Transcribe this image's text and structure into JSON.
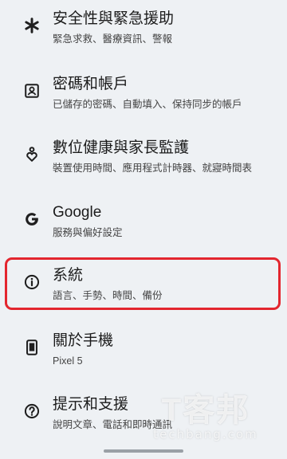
{
  "settings": {
    "items": [
      {
        "icon": "asterisk-icon",
        "title": "安全性與緊急援助",
        "subtitle": "緊急求救、醫療資訊、警報"
      },
      {
        "icon": "account-box-icon",
        "title": "密碼和帳戶",
        "subtitle": "已儲存的密碼、自動填入、保持同步的帳戶"
      },
      {
        "icon": "digital-wellbeing-icon",
        "title": "數位健康與家長監護",
        "subtitle": "裝置使用時間、應用程式計時器、就寢時間表"
      },
      {
        "icon": "google-icon",
        "title": "Google",
        "subtitle": "服務與偏好設定"
      },
      {
        "icon": "info-icon",
        "title": "系統",
        "subtitle": "語言、手勢、時間、備份"
      },
      {
        "icon": "phone-icon",
        "title": "關於手機",
        "subtitle": "Pixel 5"
      },
      {
        "icon": "help-icon",
        "title": "提示和支援",
        "subtitle": "說明文章、電話和即時通訊"
      }
    ]
  },
  "watermark": {
    "logo_text": "T客邦",
    "domain": "techbang.com"
  },
  "colors": {
    "highlight": "#e3262e",
    "background": "#eef1f4"
  }
}
